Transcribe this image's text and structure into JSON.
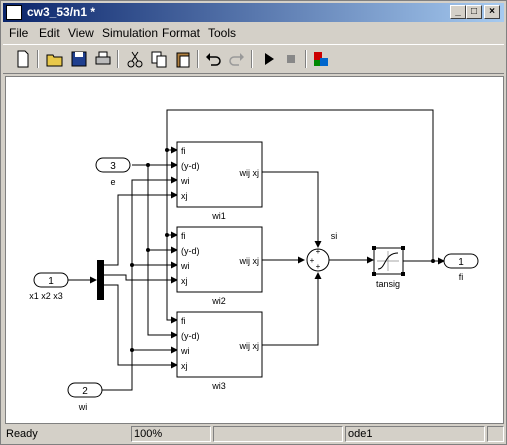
{
  "window": {
    "title": "cw3_53/n1 *"
  },
  "titlebar_buttons": {
    "minimize": "_",
    "maximize": "□",
    "close": "×"
  },
  "menu": [
    "File",
    "Edit",
    "View",
    "Simulation",
    "Format",
    "Tools"
  ],
  "toolbar": [
    "new-icon",
    "open-icon",
    "save-icon",
    "print-icon",
    "cut-icon",
    "copy-icon",
    "paste-icon",
    "undo-icon",
    "redo-icon",
    "run-icon",
    "stop-icon",
    "library-icon"
  ],
  "diagram": {
    "inports": [
      {
        "num": "3",
        "label": "e"
      },
      {
        "num": "1",
        "label": "x1 x2 x3"
      },
      {
        "num": "2",
        "label": "wi"
      }
    ],
    "outport": {
      "num": "1",
      "label": "fi"
    },
    "subsystems": [
      {
        "name": "wi1",
        "ports": [
          "fi",
          "(y-d)",
          "wi",
          "xj"
        ],
        "output": "wij xj"
      },
      {
        "name": "wi2",
        "ports": [
          "fi",
          "(y-d)",
          "wi",
          "xj"
        ],
        "output": "wij xj"
      },
      {
        "name": "wi3",
        "ports": [
          "fi",
          "(y-d)",
          "wi",
          "xj"
        ],
        "output": "wij xj"
      }
    ],
    "sum_label": "si",
    "sum_signs": [
      "+",
      "+",
      "+"
    ],
    "tansig_label": "tansig"
  },
  "status": {
    "state": "Ready",
    "zoom": "100%",
    "solver": "ode1"
  }
}
